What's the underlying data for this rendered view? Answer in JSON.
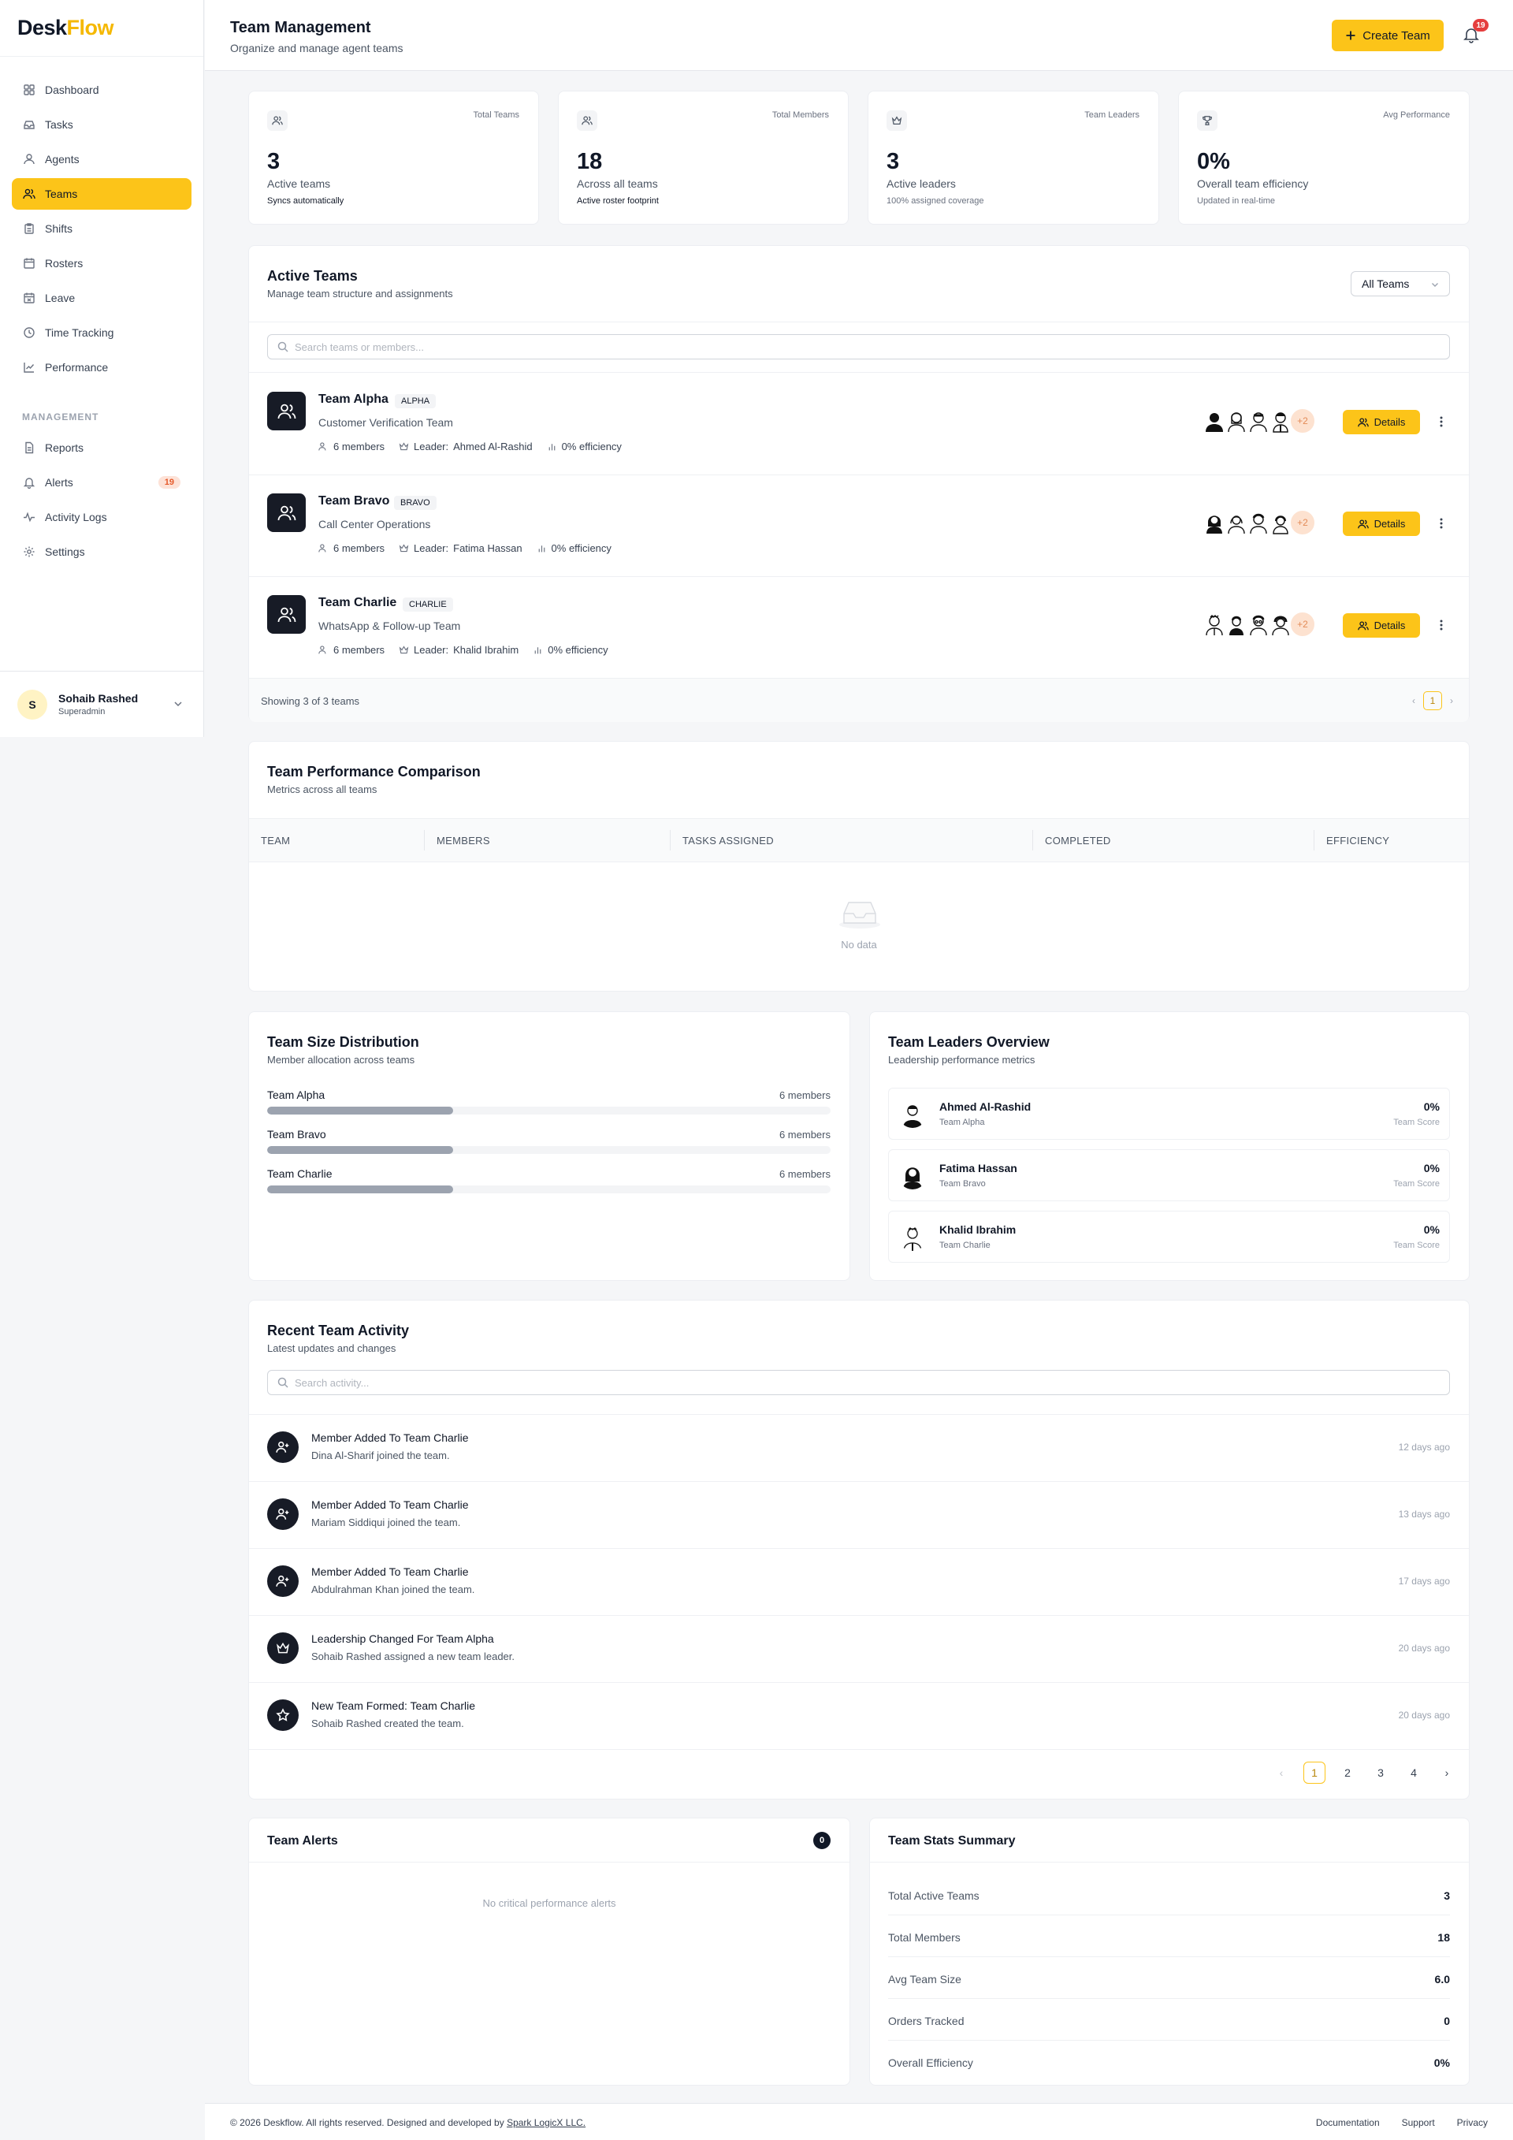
{
  "brand": {
    "first": "Desk",
    "second": "Flow"
  },
  "sidebar": {
    "items": [
      {
        "label": "Dashboard"
      },
      {
        "label": "Tasks"
      },
      {
        "label": "Agents"
      },
      {
        "label": "Teams"
      },
      {
        "label": "Shifts"
      },
      {
        "label": "Rosters"
      },
      {
        "label": "Leave"
      },
      {
        "label": "Time Tracking"
      },
      {
        "label": "Performance"
      }
    ],
    "section_label": "MANAGEMENT",
    "mgmt_items": [
      {
        "label": "Reports"
      },
      {
        "label": "Alerts",
        "badge": "19"
      },
      {
        "label": "Activity Logs"
      },
      {
        "label": "Settings"
      }
    ],
    "active": "Teams"
  },
  "user": {
    "initial": "S",
    "name": "Sohaib Rashed",
    "role": "Superadmin"
  },
  "header": {
    "title": "Team Management",
    "subtitle": "Organize and manage agent teams",
    "create_label": "Create Team",
    "notif_count": "19"
  },
  "stats": [
    {
      "label": "Total Teams",
      "value": "3",
      "sub1": "Active teams",
      "sub2": "Syncs automatically"
    },
    {
      "label": "Total Members",
      "value": "18",
      "sub1": "Across all teams",
      "sub2": "Active roster footprint"
    },
    {
      "label": "Team Leaders",
      "value": "3",
      "sub1": "Active leaders",
      "sub2": "100% assigned coverage"
    },
    {
      "label": "Avg Performance",
      "value": "0%",
      "sub1": "Overall team efficiency",
      "sub2": "Updated in real-time"
    }
  ],
  "active_teams": {
    "title": "Active Teams",
    "subtitle": "Manage team structure and assignments",
    "filter_value": "All Teams",
    "search_placeholder": "Search teams or members...",
    "teams": [
      {
        "name": "Team Alpha",
        "code": "ALPHA",
        "desc": "Customer Verification Team",
        "members": "6 members",
        "leader_label": "Leader:",
        "leader": "Ahmed Al-Rashid",
        "efficiency": "0% efficiency",
        "more": "+2",
        "details": "Details"
      },
      {
        "name": "Team Bravo",
        "code": "BRAVO",
        "desc": "Call Center Operations",
        "members": "6 members",
        "leader_label": "Leader:",
        "leader": "Fatima Hassan",
        "efficiency": "0% efficiency",
        "more": "+2",
        "details": "Details"
      },
      {
        "name": "Team Charlie",
        "code": "CHARLIE",
        "desc": "WhatsApp & Follow-up Team",
        "members": "6 members",
        "leader_label": "Leader:",
        "leader": "Khalid Ibrahim",
        "efficiency": "0% efficiency",
        "more": "+2",
        "details": "Details"
      }
    ],
    "showing": "Showing 3 of 3 teams",
    "page": "1"
  },
  "comparison": {
    "title": "Team Performance Comparison",
    "subtitle": "Metrics across all teams",
    "columns": [
      "TEAM",
      "MEMBERS",
      "TASKS ASSIGNED",
      "COMPLETED",
      "EFFICIENCY"
    ],
    "empty": "No data"
  },
  "distribution": {
    "title": "Team Size Distribution",
    "subtitle": "Member allocation across teams",
    "rows": [
      {
        "team": "Team Alpha",
        "count": "6 members",
        "fraction": 0.33
      },
      {
        "team": "Team Bravo",
        "count": "6 members",
        "fraction": 0.33
      },
      {
        "team": "Team Charlie",
        "count": "6 members",
        "fraction": 0.33
      }
    ]
  },
  "leaders": {
    "title": "Team Leaders Overview",
    "subtitle": "Leadership performance metrics",
    "rows": [
      {
        "name": "Ahmed Al-Rashid",
        "team": "Team Alpha",
        "score": "0%",
        "score_label": "Team Score"
      },
      {
        "name": "Fatima Hassan",
        "team": "Team Bravo",
        "score": "0%",
        "score_label": "Team Score"
      },
      {
        "name": "Khalid Ibrahim",
        "team": "Team Charlie",
        "score": "0%",
        "score_label": "Team Score"
      }
    ]
  },
  "activity": {
    "title": "Recent Team Activity",
    "subtitle": "Latest updates and changes",
    "search_placeholder": "Search activity...",
    "items": [
      {
        "title": "Member Added To Team Charlie",
        "desc": "Dina Al-Sharif joined the team.",
        "time": "12 days ago",
        "icon": "user-plus-icon"
      },
      {
        "title": "Member Added To Team Charlie",
        "desc": "Mariam Siddiqui joined the team.",
        "time": "13 days ago",
        "icon": "user-plus-icon"
      },
      {
        "title": "Member Added To Team Charlie",
        "desc": "Abdulrahman Khan joined the team.",
        "time": "17 days ago",
        "icon": "user-plus-icon"
      },
      {
        "title": "Leadership Changed For Team Alpha",
        "desc": "Sohaib Rashed assigned a new team leader.",
        "time": "20 days ago",
        "icon": "crown-icon"
      },
      {
        "title": "New Team Formed: Team Charlie",
        "desc": "Sohaib Rashed created the team.",
        "time": "20 days ago",
        "icon": "star-icon"
      }
    ],
    "pages": [
      "1",
      "2",
      "3",
      "4"
    ],
    "current_page": "1"
  },
  "alerts": {
    "title": "Team Alerts",
    "count": "0",
    "empty": "No critical performance alerts"
  },
  "summary": {
    "title": "Team Stats Summary",
    "rows": [
      {
        "k": "Total Active Teams",
        "v": "3"
      },
      {
        "k": "Total Members",
        "v": "18"
      },
      {
        "k": "Avg Team Size",
        "v": "6.0"
      },
      {
        "k": "Orders Tracked",
        "v": "0"
      },
      {
        "k": "Overall Efficiency",
        "v": "0%"
      }
    ]
  },
  "footer": {
    "copy": "© 2026 Deskflow. All rights reserved. Designed and developed by",
    "company": "Spark LogicX LLC.",
    "links": [
      "Documentation",
      "Support",
      "Privacy"
    ]
  },
  "colors": {
    "accent": "#fcc419",
    "dark": "#171b26",
    "danger": "#e53e3e"
  }
}
